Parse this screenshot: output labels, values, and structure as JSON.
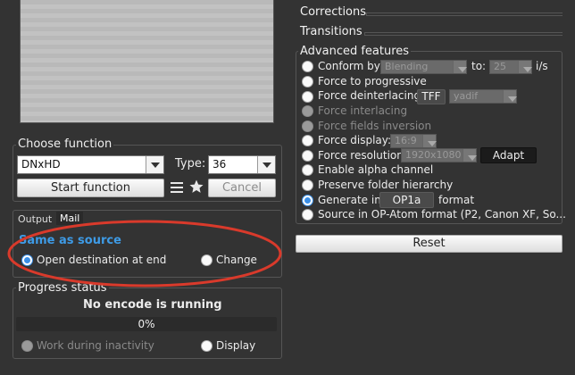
{
  "right": {
    "corrections": "Corrections",
    "transitions": "Transitions",
    "advanced_title": "Advanced features",
    "conform_by": "Conform by:",
    "conform_value": "Blending",
    "to_label": "to:",
    "fps_value": "25",
    "fps_unit": "i/s",
    "force_progressive": "Force to progressive",
    "force_deinterlacing": "Force deinterlacing:",
    "tff": "TFF",
    "deint_value": "yadif",
    "force_interlacing": "Force interlacing",
    "force_fields_inversion": "Force fields inversion",
    "force_display": "Force display:",
    "display_value": "16:9",
    "force_resolution": "Force resolution:",
    "resolution_value": "1920x1080",
    "adapt": "Adapt",
    "enable_alpha": "Enable alpha channel",
    "preserve_folder": "Preserve folder hierarchy",
    "generate_in": "Generate in",
    "op1a": "OP1a",
    "format": "format",
    "source_op_atom": "Source in OP-Atom format (P2, Canon XF, So...",
    "reset": "Reset"
  },
  "left": {
    "choose_function": "Choose function",
    "function_value": "DNxHD",
    "type_label": "Type:",
    "type_value": "36",
    "start_function": "Start function",
    "cancel": "Cancel",
    "tab_output": "Output",
    "tab_mail": "Mail",
    "same_as_source": "Same as source",
    "open_destination": "Open destination at end",
    "change": "Change",
    "progress_status": "Progress status",
    "no_encode": "No encode is running",
    "progress_text": "0%",
    "progress_value": 0,
    "work_during_inactivity": "Work during inactivity",
    "display": "Display"
  },
  "colors": {
    "background": "#333333",
    "accent": "#3e9be6",
    "annotation_oval": "#d93a2b"
  }
}
